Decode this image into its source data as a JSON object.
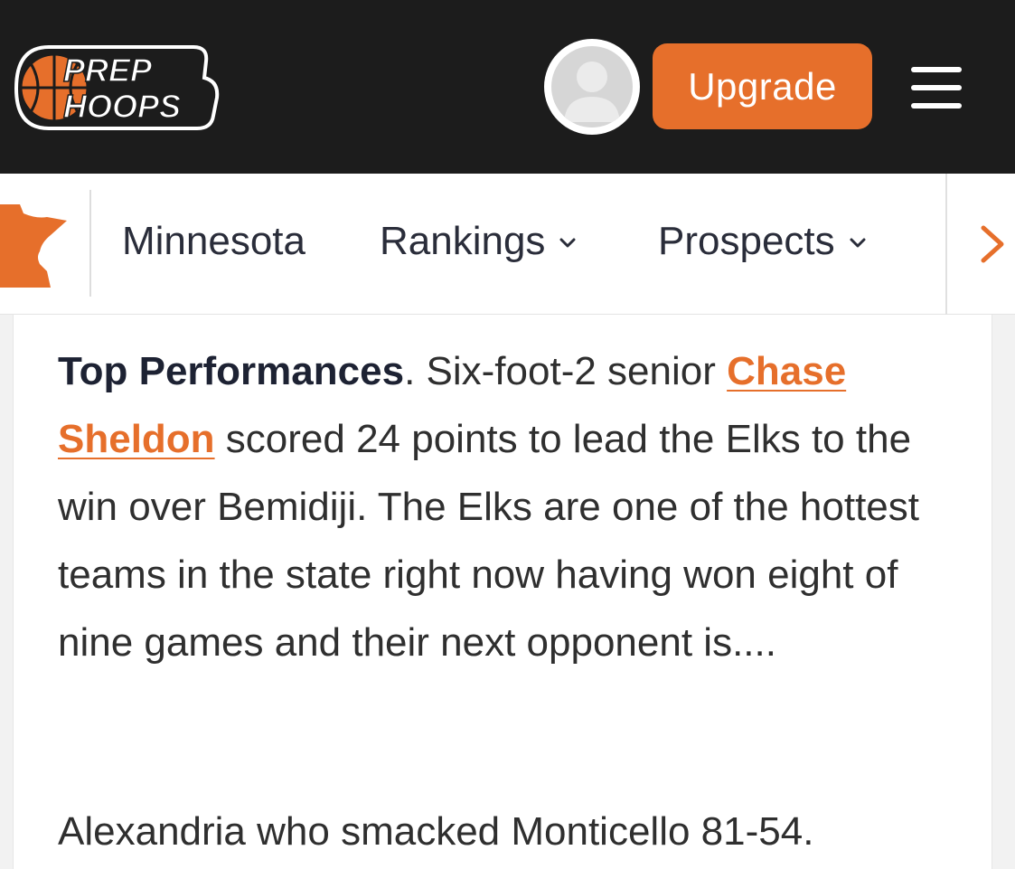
{
  "header": {
    "logo": {
      "line1": "PREP",
      "line2": "HOOPS"
    },
    "avatar_icon": "user-avatar-placeholder",
    "upgrade_label": "Upgrade",
    "menu_icon": "hamburger-icon"
  },
  "nav": {
    "state_icon": "minnesota-map-icon",
    "items": [
      {
        "label": "Minnesota"
      },
      {
        "label": "Rankings"
      },
      {
        "label": "Prospects"
      }
    ],
    "next_icon": "chevron-right-icon"
  },
  "article": {
    "para1": {
      "lead": "Top Performances",
      "after_lead": ". Six-foot-2 senior ",
      "link": "Chase Sheldon",
      "rest": " scored 24 points to lead the Elks to the win over Bemidiji. The Elks are one of the hottest teams in the state right now having won eight of nine games and their next opponent is...."
    },
    "para2": "Alexandria who smacked Monticello 81-54."
  },
  "colors": {
    "brand_orange": "#e66f2b",
    "header_bg": "#1c1c1c"
  }
}
